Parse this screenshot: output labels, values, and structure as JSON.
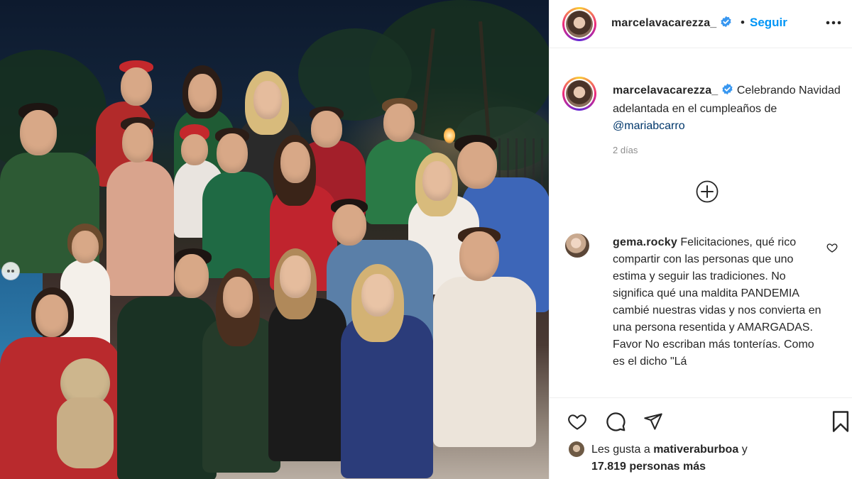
{
  "photo": {
    "alt_icon": "photo"
  },
  "post": {
    "username": "marcelavacarezza_",
    "separator": "•",
    "follow_label": "Seguir",
    "caption_text": "Celebrando Navidad adelantada en el cumpleaños de",
    "caption_mention": "@mariabcarro",
    "timestamp": "2 días"
  },
  "comment": {
    "username": "gema.rocky",
    "text": "Felicitaciones, qué rico compartir con las personas que uno estima y seguir las tradiciones. No significa qué una maldita PANDEMIA cambié nuestras vidas y nos convierta en una persona resentida y AMARGADAS. Favor No escriban más tonterías. Como es el dicho \"Lá"
  },
  "likes": {
    "prefix": "Les gusta a",
    "user": "mativeraburboa",
    "conjunction": "y",
    "count_text": "17.819 personas más"
  },
  "colors": {
    "accent": "#0095f6",
    "verified": "#3897f0",
    "mention": "#00376b",
    "muted": "#8e8e8e"
  }
}
